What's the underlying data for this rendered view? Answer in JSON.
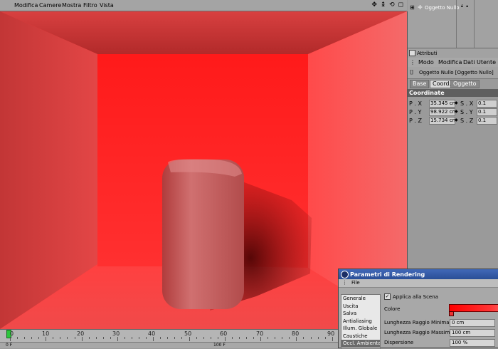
{
  "menubar": {
    "items": [
      "Modifica",
      "Camere",
      "Mostra",
      "Filtro",
      "Vista"
    ],
    "nav_icons": "✥ ↨ ⟲ ◻"
  },
  "object_manager": {
    "object_name": "Oggetto Nullo"
  },
  "attributes": {
    "header": "Attributi",
    "menu": [
      "Modo",
      "Modifica",
      "Dati Utente"
    ],
    "title": "Oggetto Nullo [Oggetto Nullo]",
    "tabs": [
      "Base",
      "Coord.",
      "Oggetto"
    ],
    "active_tab": "Coord.",
    "section": "Coordinate",
    "rows": [
      {
        "plabel": "P . X",
        "pvalue": "35.345 cm",
        "slabel": "S . X",
        "svalue": "0.1"
      },
      {
        "plabel": "P . Y",
        "pvalue": "98.922 cm",
        "slabel": "S . Y",
        "svalue": "0.1"
      },
      {
        "plabel": "P . Z",
        "pvalue": "15.734 cm",
        "slabel": "S . Z",
        "svalue": "0.1"
      }
    ]
  },
  "timeline": {
    "ticks": [
      "0",
      "10",
      "20",
      "30",
      "40",
      "50",
      "60",
      "70",
      "80",
      "90"
    ],
    "left_field": "0 F",
    "right_field": "100 F"
  },
  "render_dialog": {
    "title": "Parametri di Rendering",
    "menu": "File",
    "list": [
      "Generale",
      "Uscita",
      "Salva",
      "Antialiasing",
      "Illum. Globale",
      "Caustiche",
      "Occl. Ambientale"
    ],
    "selected": "Occl. Ambientale",
    "apply_label": "Applica alla Scena",
    "color_label": "Colore",
    "min_label": "Lunghezza Raggio Minima",
    "min_value": "0 cm",
    "max_label": "Lunghezza Raggio Massima",
    "max_value": "100 cm",
    "disp_label": "Dispersione",
    "disp_value": "100 %"
  },
  "colors": {
    "accent_title": "#2a4e96",
    "scene_red": "#ff3333",
    "playhead": "#2dc63c"
  }
}
